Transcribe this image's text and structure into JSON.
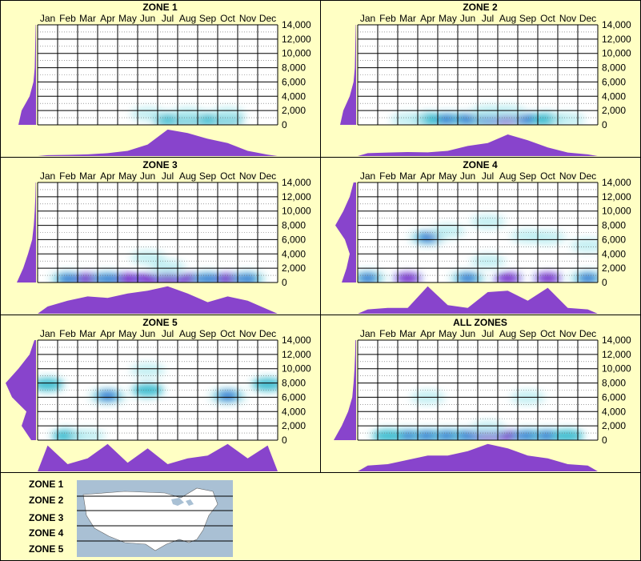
{
  "chart_data": {
    "type": "heatmap",
    "months": [
      "Jan",
      "Feb",
      "Mar",
      "Apr",
      "May",
      "Jun",
      "Jul",
      "Aug",
      "Sep",
      "Oct",
      "Nov",
      "Dec"
    ],
    "yticks": [
      "14,000",
      "12,000",
      "10,000",
      "8,000",
      "6,000",
      "4,000",
      "2,000",
      "0"
    ],
    "ylim": [
      0,
      14000
    ],
    "panels": [
      {
        "title": "ZONE 1",
        "hot": [
          [
            6,
            750,
            "med"
          ],
          [
            7,
            750,
            "med"
          ],
          [
            8,
            750,
            "med"
          ],
          [
            9,
            750,
            "med"
          ],
          [
            5,
            1500,
            "light"
          ],
          [
            7,
            1500,
            "light"
          ],
          [
            9,
            1500,
            "light"
          ]
        ],
        "month_profile": [
          0.03,
          0.04,
          0.06,
          0.1,
          0.18,
          0.4,
          0.92,
          0.8,
          0.6,
          0.45,
          0.18,
          0.05
        ],
        "elev_profile": [
          0.55,
          0.45,
          0.2,
          0.08,
          0.04,
          0.03,
          0.02,
          0.01
        ]
      },
      {
        "title": "ZONE 2",
        "hot": [
          [
            3,
            750,
            "med"
          ],
          [
            4,
            750,
            "dark"
          ],
          [
            5,
            750,
            "dark"
          ],
          [
            6,
            750,
            "dark"
          ],
          [
            7,
            750,
            "hot"
          ],
          [
            8,
            750,
            "dark"
          ],
          [
            9,
            750,
            "med"
          ],
          [
            2,
            750,
            "light"
          ],
          [
            10,
            750,
            "light"
          ],
          [
            6,
            1800,
            "light"
          ],
          [
            7,
            1800,
            "light"
          ]
        ],
        "month_profile": [
          0.1,
          0.12,
          0.14,
          0.13,
          0.18,
          0.35,
          0.45,
          0.75,
          0.55,
          0.3,
          0.12,
          0.06
        ],
        "elev_profile": [
          0.5,
          0.4,
          0.2,
          0.08,
          0.04,
          0.03,
          0.02,
          0.01
        ]
      },
      {
        "title": "ZONE 3",
        "hot": [
          [
            1,
            500,
            "dark"
          ],
          [
            2,
            500,
            "hot"
          ],
          [
            3,
            500,
            "dark"
          ],
          [
            4,
            500,
            "hot"
          ],
          [
            5,
            500,
            "hot"
          ],
          [
            6,
            500,
            "hot"
          ],
          [
            7,
            500,
            "hot"
          ],
          [
            8,
            500,
            "dark"
          ],
          [
            9,
            500,
            "hot"
          ],
          [
            10,
            500,
            "dark"
          ],
          [
            5,
            3500,
            "light"
          ],
          [
            6,
            2200,
            "light"
          ]
        ],
        "month_profile": [
          0.25,
          0.45,
          0.6,
          0.55,
          0.7,
          0.8,
          0.95,
          0.7,
          0.4,
          0.6,
          0.45,
          0.15
        ],
        "elev_profile": [
          0.6,
          0.4,
          0.25,
          0.12,
          0.07,
          0.04,
          0.02,
          0.01
        ]
      },
      {
        "title": "ZONE 4",
        "hot": [
          [
            3,
            6300,
            "dark"
          ],
          [
            4,
            7200,
            "light"
          ],
          [
            6,
            8500,
            "light"
          ],
          [
            8,
            6500,
            "light"
          ],
          [
            9,
            6300,
            "light"
          ],
          [
            11,
            5200,
            "light"
          ],
          [
            0,
            600,
            "dark"
          ],
          [
            2,
            600,
            "hot"
          ],
          [
            5,
            600,
            "dark"
          ],
          [
            7,
            600,
            "hot"
          ],
          [
            9,
            600,
            "hot"
          ],
          [
            11,
            600,
            "dark"
          ],
          [
            6,
            3000,
            "light"
          ]
        ],
        "month_profile": [
          0.15,
          0.2,
          0.2,
          0.95,
          0.3,
          0.2,
          0.75,
          0.8,
          0.45,
          0.9,
          0.2,
          0.15
        ],
        "elev_profile": [
          0.45,
          0.3,
          0.2,
          0.35,
          0.65,
          0.4,
          0.2,
          0.08
        ]
      },
      {
        "title": "ZONE 5",
        "hot": [
          [
            0,
            7800,
            "med"
          ],
          [
            3,
            6200,
            "dark"
          ],
          [
            5,
            7000,
            "med"
          ],
          [
            9,
            6200,
            "dark"
          ],
          [
            11,
            7800,
            "med"
          ],
          [
            1,
            600,
            "med"
          ],
          [
            2,
            600,
            "light"
          ],
          [
            5,
            9800,
            "light"
          ]
        ],
        "month_profile": [
          0.9,
          0.25,
          0.45,
          0.95,
          0.3,
          0.8,
          0.25,
          0.45,
          0.55,
          0.95,
          0.45,
          0.9
        ],
        "elev_profile": [
          0.15,
          0.45,
          0.3,
          0.75,
          0.95,
          0.55,
          0.2,
          0.05
        ]
      },
      {
        "title": "ALL ZONES",
        "hot": [
          [
            2,
            600,
            "dark"
          ],
          [
            3,
            600,
            "dark"
          ],
          [
            4,
            600,
            "dark"
          ],
          [
            5,
            600,
            "dark"
          ],
          [
            6,
            600,
            "hot"
          ],
          [
            7,
            600,
            "hot"
          ],
          [
            8,
            600,
            "dark"
          ],
          [
            9,
            600,
            "dark"
          ],
          [
            10,
            600,
            "med"
          ],
          [
            1,
            600,
            "med"
          ],
          [
            6,
            1700,
            "light"
          ],
          [
            3,
            6000,
            "light"
          ],
          [
            8,
            6000,
            "light"
          ]
        ],
        "month_profile": [
          0.2,
          0.25,
          0.4,
          0.55,
          0.55,
          0.7,
          0.95,
          0.8,
          0.55,
          0.45,
          0.25,
          0.2
        ],
        "elev_profile": [
          0.7,
          0.45,
          0.25,
          0.12,
          0.08,
          0.05,
          0.03,
          0.02
        ]
      }
    ]
  },
  "legend": {
    "zones": [
      "ZONE 1",
      "ZONE 2",
      "ZONE 3",
      "ZONE 4",
      "ZONE 5"
    ]
  },
  "colors": {
    "background": "#ffffc4",
    "profile_fill": "#8844cc",
    "grid": "#000000",
    "light": "#b8ecf0",
    "med": "#33b8cc",
    "dark": "#0000cc",
    "hot": "#ff0099"
  }
}
